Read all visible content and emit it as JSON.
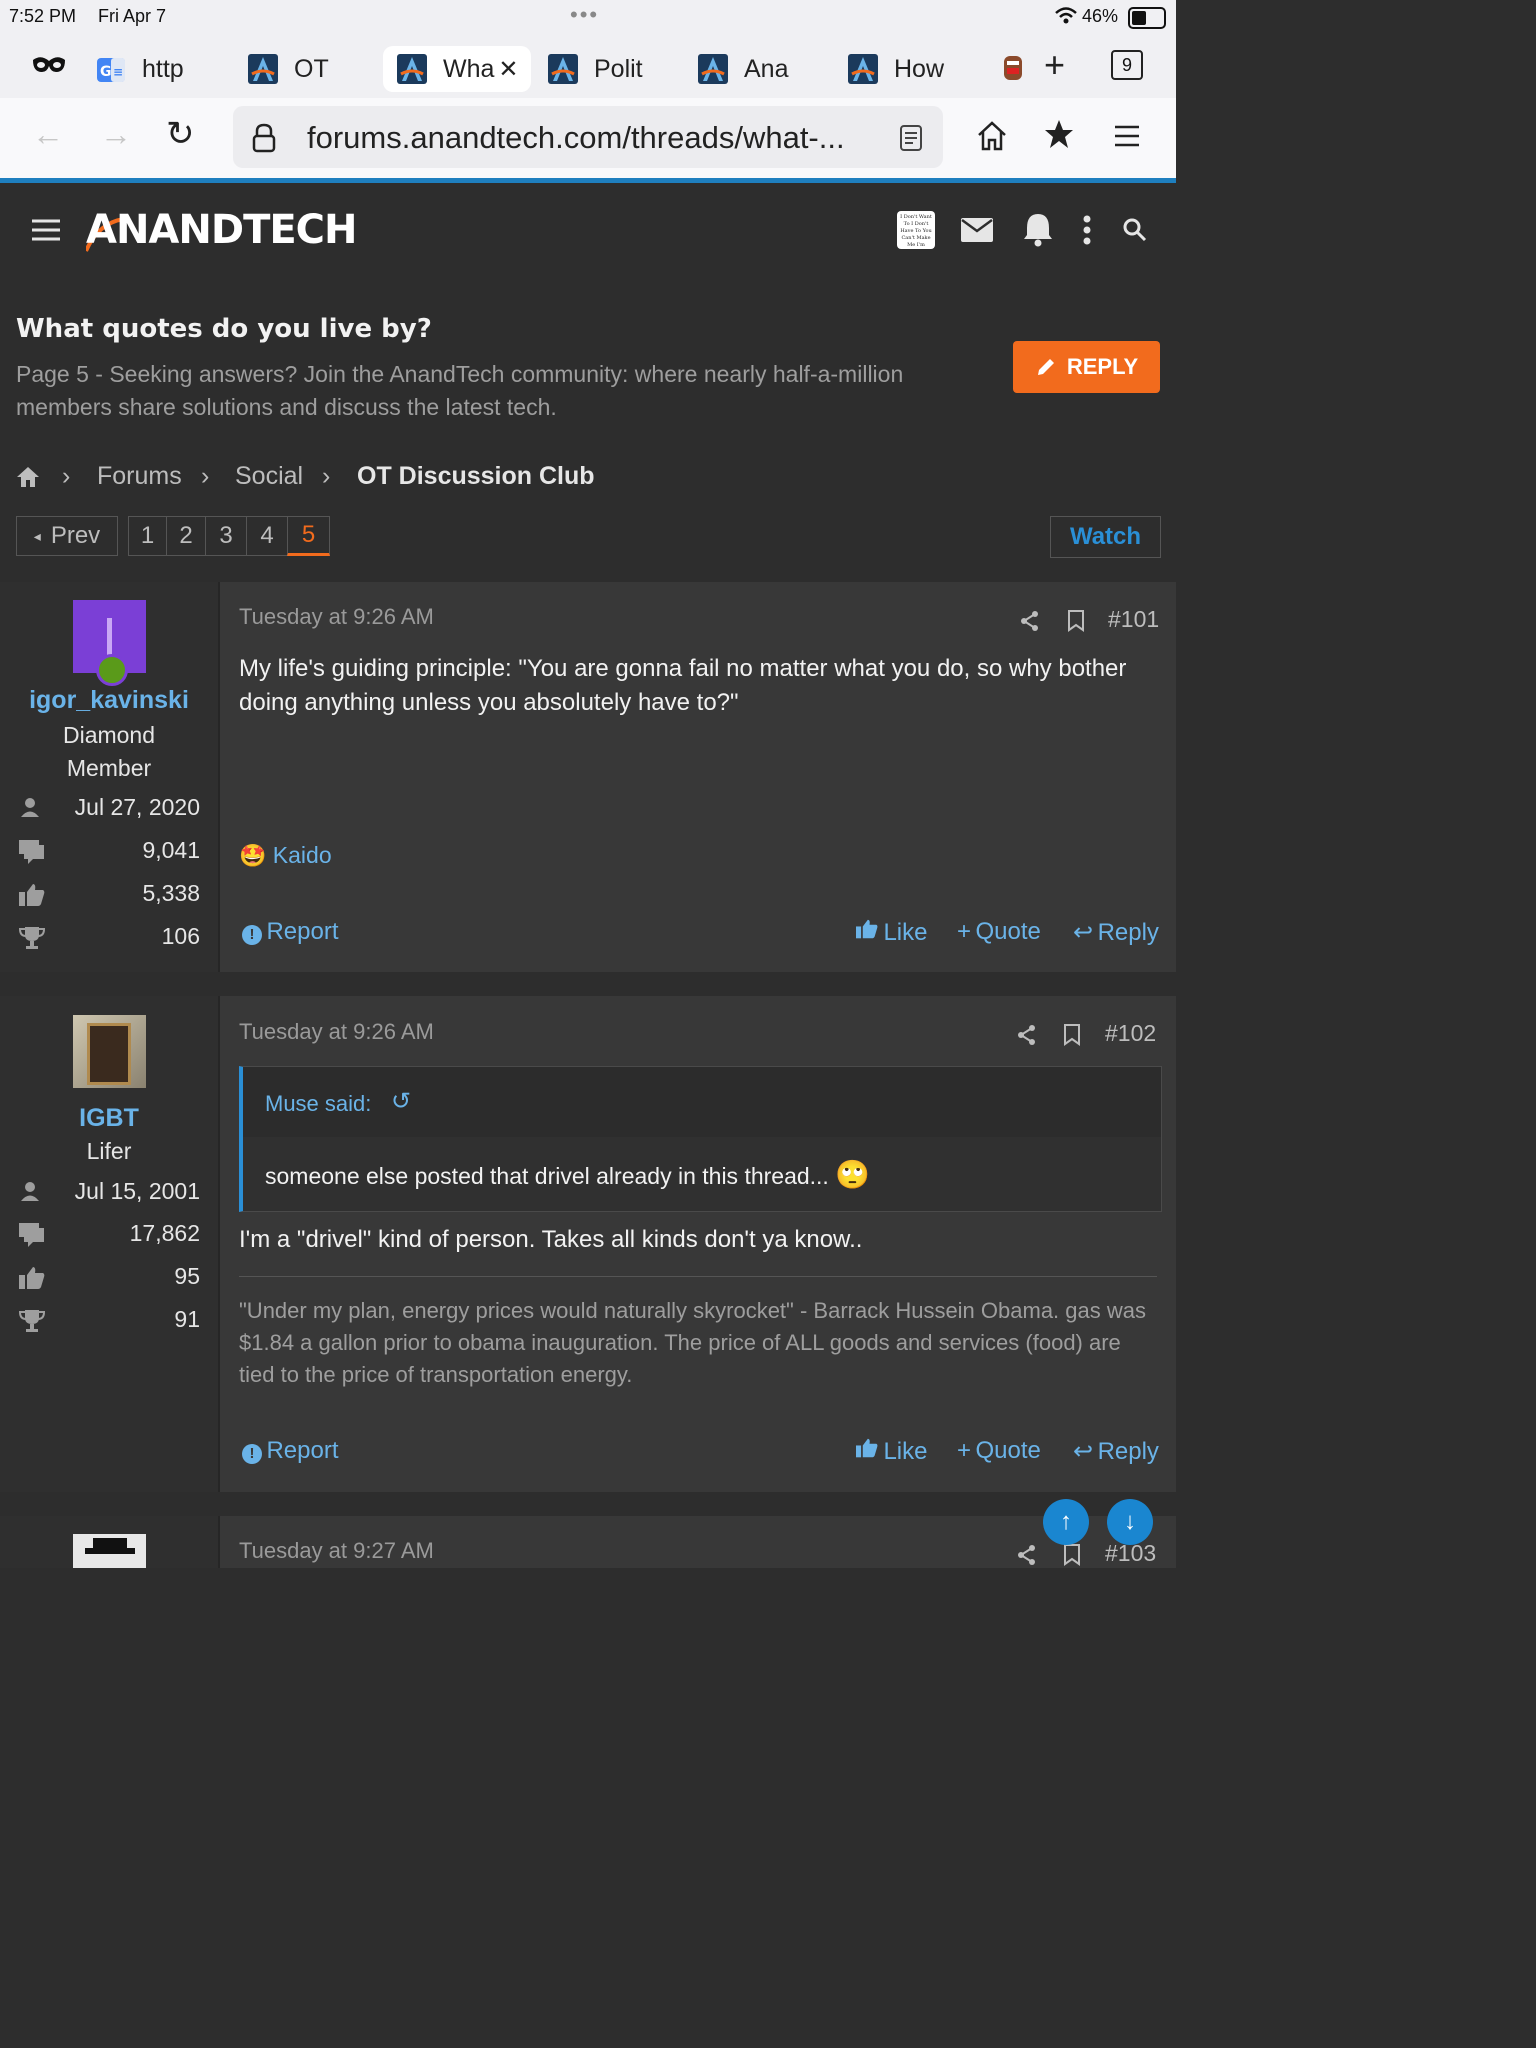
{
  "status": {
    "time": "7:52 PM",
    "date": "Fri Apr 7",
    "battery": "46%"
  },
  "tabs": [
    {
      "label": "http"
    },
    {
      "label": "OT"
    },
    {
      "label": "Wha"
    },
    {
      "label": "Polit"
    },
    {
      "label": "Ana"
    },
    {
      "label": "How"
    }
  ],
  "tab_count": "9",
  "url": "forums.anandtech.com/threads/what-...",
  "site": {
    "logo": "ANANDTECH",
    "avatar_text": "I Don't Want To I Don't Have To You Can't Make Me I'm Retired"
  },
  "thread": {
    "title": "What quotes do you live by?",
    "subtitle": "Page 5 - Seeking answers? Join the AnandTech community: where nearly half-a-million members share solutions and discuss the latest tech.",
    "reply_label": "REPLY"
  },
  "breadcrumb": {
    "forums": "Forums",
    "social": "Social",
    "current": "OT Discussion Club"
  },
  "pagination": {
    "prev": "Prev",
    "pages": [
      "1",
      "2",
      "3",
      "4",
      "5"
    ],
    "current": "5",
    "watch": "Watch"
  },
  "posts": [
    {
      "author": "igor_kavinski",
      "title_line1": "Diamond",
      "title_line2": "Member",
      "joined": "Jul 27, 2020",
      "messages": "9,041",
      "reactions": "5,338",
      "points": "106",
      "time": "Tuesday at 9:26 AM",
      "number": "#101",
      "body": "My life's guiding principle: \"You are gonna fail no matter what you do, so why bother doing anything unless you absolutely have to?\"",
      "reaction_user": "Kaido"
    },
    {
      "author": "IGBT",
      "title_line1": "Lifer",
      "joined": "Jul 15, 2001",
      "messages": "17,862",
      "reactions": "95",
      "points": "91",
      "time": "Tuesday at 9:26 AM",
      "number": "#102",
      "quote_author": "Muse said:",
      "quote_body": "someone else posted that drivel already in this thread...",
      "body": "I'm a \"drivel\" kind of person. Takes all kinds don't ya know..",
      "signature": "\"Under my plan, energy prices would naturally skyrocket\" - Barrack Hussein Obama. gas was $1.84 a gallon prior to obama inauguration. The price of ALL goods and services (food) are tied to the price of transportation energy."
    },
    {
      "time": "Tuesday at 9:27 AM",
      "number": "#103"
    }
  ],
  "actions": {
    "report": "Report",
    "like": "Like",
    "quote": "Quote",
    "reply": "Reply"
  },
  "colors": {
    "accent_orange": "#f26b1d",
    "link_blue": "#6ab3e8",
    "header_bar": "#1e7fbf"
  }
}
